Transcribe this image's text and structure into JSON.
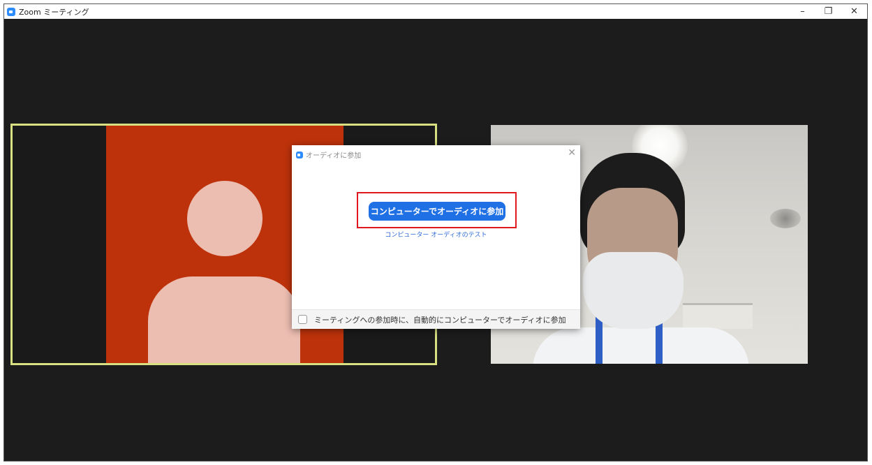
{
  "window": {
    "title": "Zoom ミーティング",
    "controls": {
      "minimize": "–",
      "restore": "❐",
      "close": "✕"
    }
  },
  "dialog": {
    "title": "オーディオに参加",
    "close_icon": "✕",
    "join_button": "コンピューターでオーディオに参加",
    "test_link": "コンピューター オーディオのテスト",
    "auto_join_label": "ミーティングへの参加時に、自動的にコンピューターでオーディオに参加",
    "auto_join_checked": false
  },
  "participants": [
    {
      "type": "avatar",
      "active_speaker": true
    },
    {
      "type": "video",
      "active_speaker": false
    }
  ],
  "colors": {
    "accent": "#1f6fe5",
    "avatar_bg": "#bd320b",
    "active_border": "#d8e082",
    "highlight": "#e1181f"
  },
  "icons": [
    "zoom-app-icon",
    "minimize-icon",
    "restore-icon",
    "close-icon",
    "zoom-dialog-icon",
    "dialog-close-icon"
  ]
}
